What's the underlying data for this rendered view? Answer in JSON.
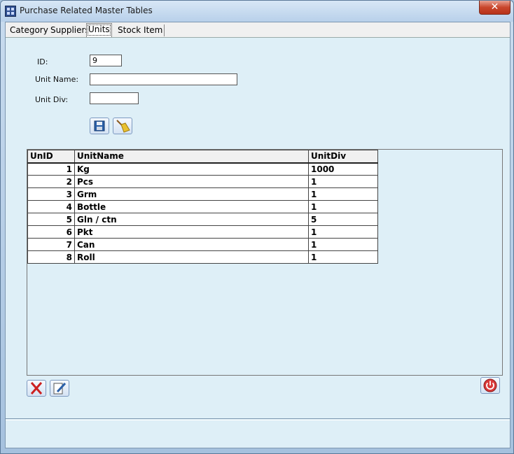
{
  "window": {
    "title": "Purchase Related Master Tables",
    "close_label": "✕"
  },
  "tabs": [
    {
      "label": "Category"
    },
    {
      "label": "Suppliers"
    },
    {
      "label": "Units"
    },
    {
      "label": "Stock Item"
    }
  ],
  "form": {
    "id_label": "ID:",
    "id_value": "9",
    "unit_name_label": "Unit Name:",
    "unit_name_value": "",
    "unit_div_label": "Unit Div:",
    "unit_div_value": ""
  },
  "grid": {
    "columns": [
      "UnID",
      "UnitName",
      "UnitDiv"
    ],
    "rows": [
      [
        "1",
        "Kg",
        "1000"
      ],
      [
        "2",
        "Pcs",
        "1"
      ],
      [
        "3",
        "Grm",
        "1"
      ],
      [
        "4",
        "Bottle",
        "1"
      ],
      [
        "5",
        "Gln / ctn",
        "5"
      ],
      [
        "6",
        "Pkt",
        "1"
      ],
      [
        "7",
        "Can",
        "1"
      ],
      [
        "8",
        "Roll",
        "1"
      ]
    ]
  },
  "icons": {
    "save": "floppy-disk-icon",
    "clear": "broom-icon",
    "delete": "red-x-icon",
    "edit": "edit-document-icon",
    "exit": "power-icon"
  },
  "colors": {
    "client_bg": "#deeff7",
    "close_red": "#c9462c",
    "power_red": "#d93a3a"
  }
}
